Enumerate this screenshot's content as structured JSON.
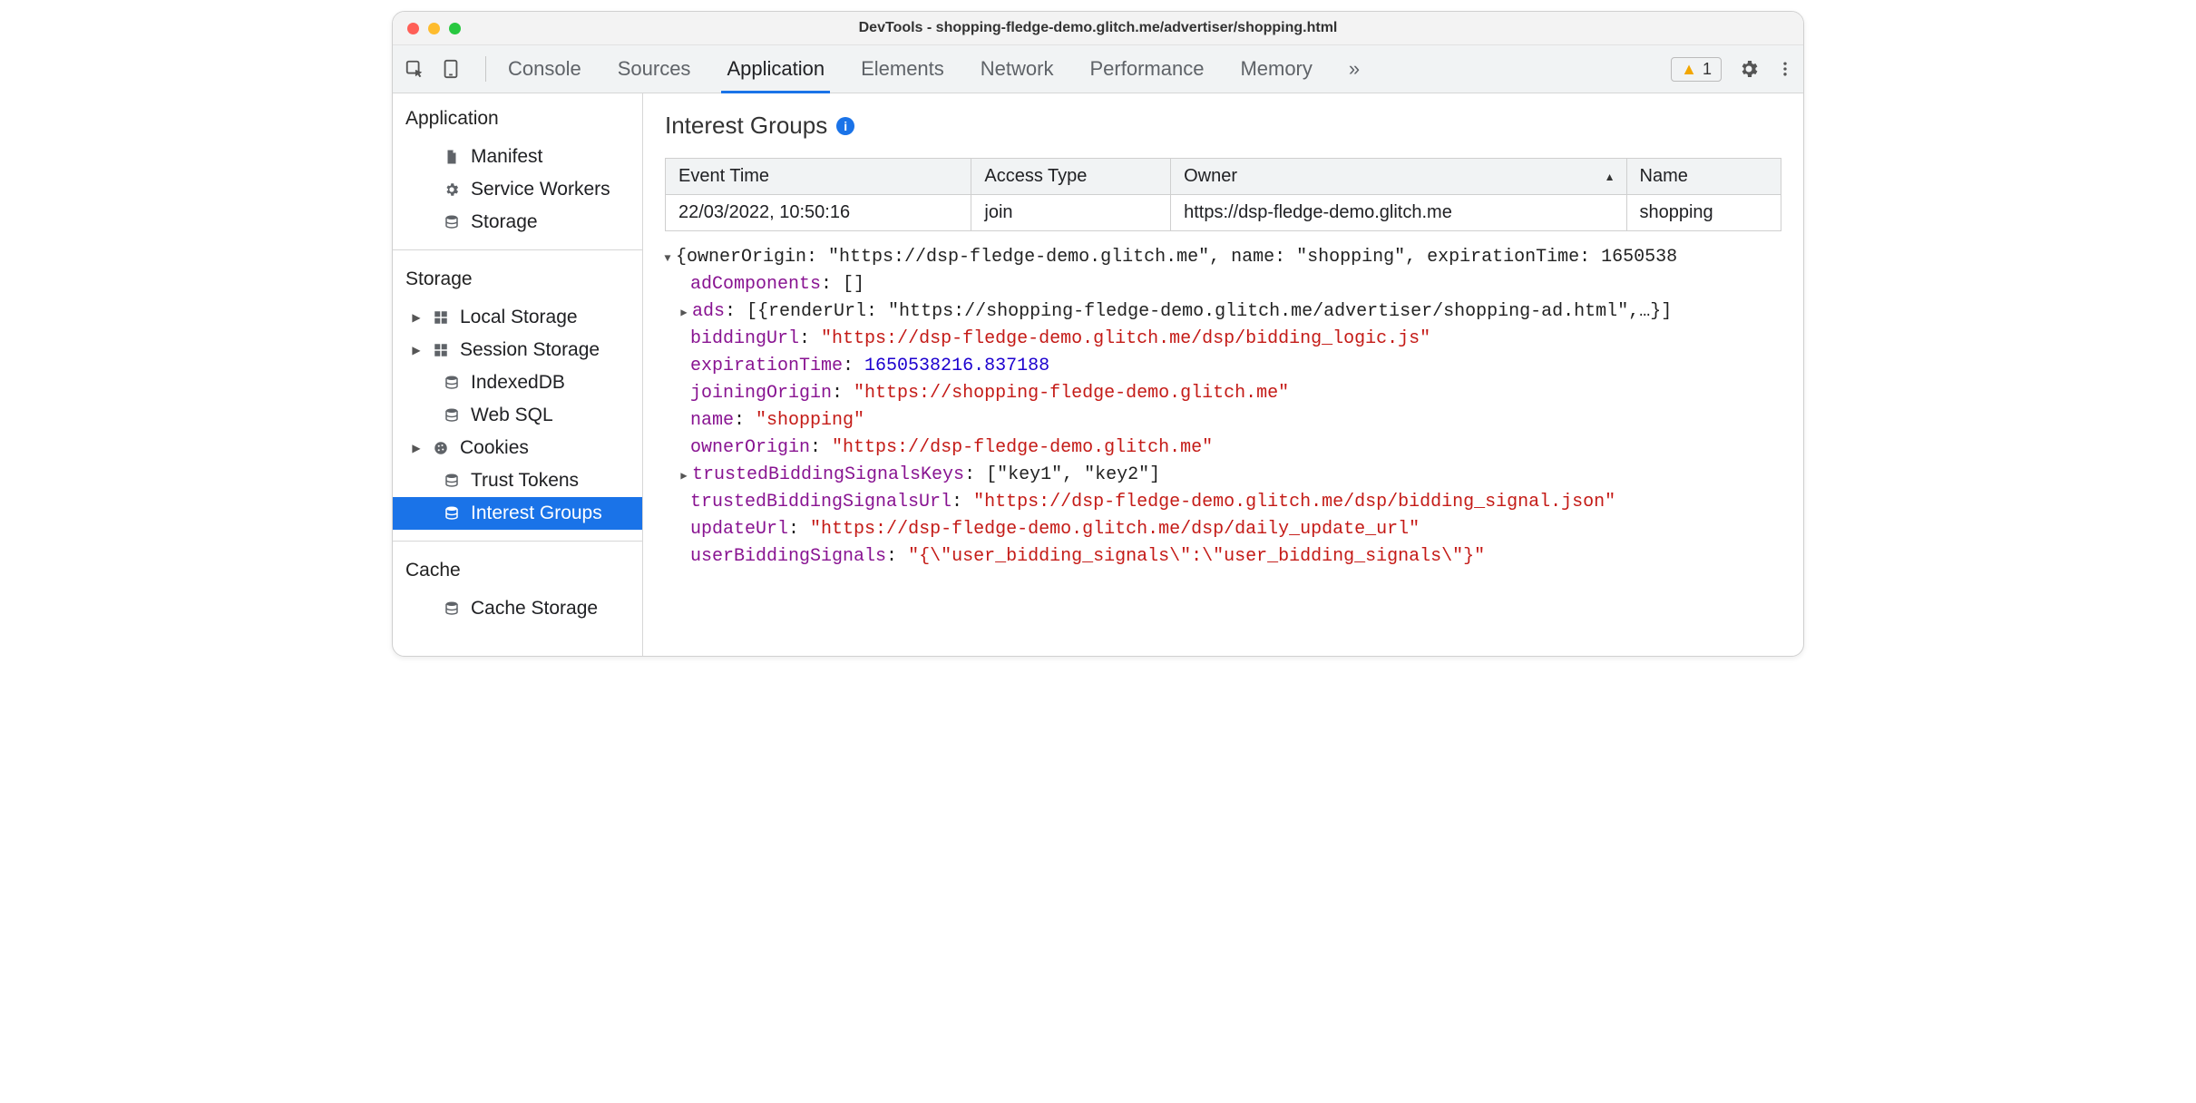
{
  "window": {
    "title": "DevTools - shopping-fledge-demo.glitch.me/advertiser/shopping.html"
  },
  "toolbar": {
    "tabs": [
      "Console",
      "Sources",
      "Application",
      "Elements",
      "Network",
      "Performance",
      "Memory"
    ],
    "active_tab_index": 2,
    "more_tabs_glyph": "»",
    "warnings_count": "1"
  },
  "sidebar": {
    "sections": [
      {
        "title": "Application",
        "items": [
          {
            "label": "Manifest",
            "icon": "file"
          },
          {
            "label": "Service Workers",
            "icon": "gear"
          },
          {
            "label": "Storage",
            "icon": "db"
          }
        ]
      },
      {
        "title": "Storage",
        "items": [
          {
            "label": "Local Storage",
            "icon": "grid",
            "expandable": true
          },
          {
            "label": "Session Storage",
            "icon": "grid",
            "expandable": true
          },
          {
            "label": "IndexedDB",
            "icon": "db"
          },
          {
            "label": "Web SQL",
            "icon": "db"
          },
          {
            "label": "Cookies",
            "icon": "cookie",
            "expandable": true
          },
          {
            "label": "Trust Tokens",
            "icon": "db"
          },
          {
            "label": "Interest Groups",
            "icon": "db",
            "selected": true
          }
        ]
      },
      {
        "title": "Cache",
        "items": [
          {
            "label": "Cache Storage",
            "icon": "db"
          }
        ]
      }
    ]
  },
  "panel": {
    "title": "Interest Groups",
    "table": {
      "headers": [
        "Event Time",
        "Access Type",
        "Owner",
        "Name"
      ],
      "sort_col": 2,
      "rows": [
        [
          "22/03/2022, 10:50:16",
          "join",
          "https://dsp-fledge-demo.glitch.me",
          "shopping"
        ]
      ]
    },
    "details": {
      "topline": "{ownerOrigin: \"https://dsp-fledge-demo.glitch.me\", name: \"shopping\", expirationTime: 1650538",
      "adComponents": "[]",
      "ads_summary": "[{renderUrl: \"https://shopping-fledge-demo.glitch.me/advertiser/shopping-ad.html\",…}]",
      "biddingUrl": "\"https://dsp-fledge-demo.glitch.me/dsp/bidding_logic.js\"",
      "expirationTime": "1650538216.837188",
      "joiningOrigin": "\"https://shopping-fledge-demo.glitch.me\"",
      "name": "\"shopping\"",
      "ownerOrigin": "\"https://dsp-fledge-demo.glitch.me\"",
      "trustedBiddingSignalsKeys": "[\"key1\", \"key2\"]",
      "trustedBiddingSignalsUrl": "\"https://dsp-fledge-demo.glitch.me/dsp/bidding_signal.json\"",
      "updateUrl": "\"https://dsp-fledge-demo.glitch.me/dsp/daily_update_url\"",
      "userBiddingSignals": "\"{\\\"user_bidding_signals\\\":\\\"user_bidding_signals\\\"}\""
    }
  }
}
